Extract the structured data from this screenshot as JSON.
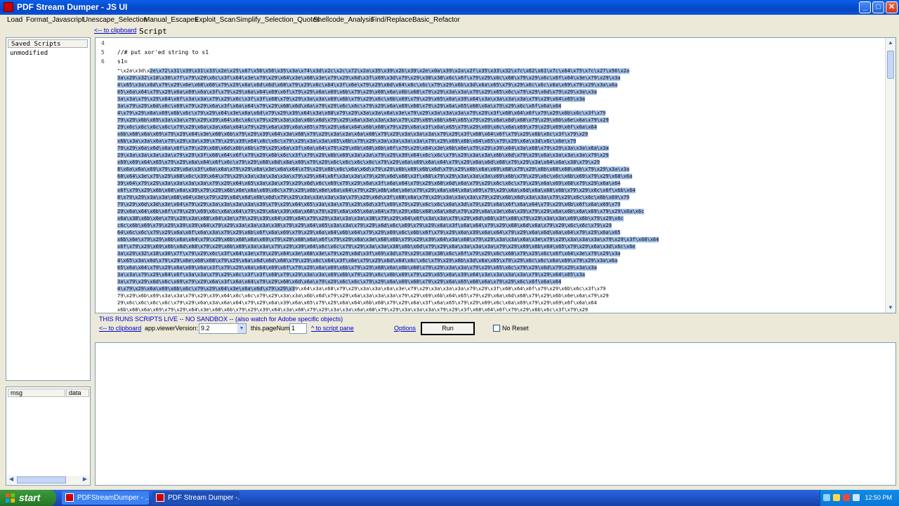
{
  "window": {
    "title": "PDF Stream Dumper  - JS UI",
    "min": "_",
    "max": "□",
    "close": "✕"
  },
  "menu": [
    "Load",
    "Format_Javascript",
    "Unescape_Selection",
    "Manual_Escapes",
    "Exploit_Scan",
    "Simplify_Selection_Quotes",
    "Shellcode_Analysis",
    "Find/Replace",
    "Basic_Refactor"
  ],
  "toolbar": {
    "clipboard_link": "<-- to clipboard",
    "script_label": "Script"
  },
  "saved_scripts": {
    "header": "Saved Scripts",
    "items": [
      "unmodified"
    ]
  },
  "editor": {
    "line_numbers": [
      "4",
      "5",
      "6"
    ],
    "comment": "//# put xor'ed string to s1",
    "assign": "s1=",
    "first_hex_row": "\"\\x2a\\x3d\\x2e\\x72\\x31\\x39\\x31\\x33\\x2e\\x25\\x67\\x56\\x56\\x35\\x3a\\x74\\x3d\\x2c\\x2c\\x72\\x2a\\x35\\x39\\x2b\\x39\\x2e\\x0a\\x39\\x2a\\x2f\\x35\\x33\\x32\\x7c\\x62\\x61\\x7c\\x64\\x75\\x7c\\x27\\x56\\x2a",
    "hex_rows": [
      "3a\\x29\\x32\\x18\\x30\\x7f\\x79\\x29\\x6c\\x3f\\x64\\x3e\\x79\\x29\\x64\\x3e\\x68\\x3e\\x79\\x29\\x6d\\x3f\\x69\\x3d\\x79\\x29\\x38\\x38\\x6c\\x6f\\x79\\x29\\x6c\\x68\\x79\\x29\\x6c\\x6f\\x64\\x3e\\x79\\x29\\x3a",
      "4\\x65\\x3a\\x6d\\x79\\x29\\x6e\\x68\\x68\\x79\\x29\\x6a\\x6d\\x6d\\x68\\x79\\x29\\x6c\\x64\\x3f\\x6e\\x79\\x29\\x6d\\x64\\x6c\\x6c\\x79\\x29\\x6b\\x3d\\x6a\\x65\\x79\\x29\\x6c\\x6c\\x6a\\x69\\x79\\x29\\x3a\\x6a",
      "65\\x6a\\x64\\x79\\x29\\x6a\\x69\\x6a\\x3f\\x79\\x29\\x6a\\x64\\x69\\x6f\\x79\\x29\\x6a\\x69\\x6b\\x79\\x29\\x68\\x6a\\x6b\\x68\\x79\\x29\\x3a\\x3a\\x79\\x29\\x65\\x6c\\x79\\x29\\x6d\\x79\\x29\\x3a\\x3a",
      "3a\\x3a\\x79\\x29\\x64\\x6f\\x3a\\x3a\\x79\\x29\\x6c\\x3f\\x3f\\x68\\x79\\x29\\x3a\\x3a\\x69\\x6b\\x79\\x29\\x6c\\x6b\\x69\\x79\\x29\\x65\\x6a\\x39\\x64\\x3a\\x3a\\x3a\\x3a\\x79\\x29\\x64\\x65\\x3a",
      "3a\\x79\\x29\\x6d\\x6c\\x69\\x79\\x29\\x6a\\x3f\\x6a\\x64\\x79\\x29\\x68\\x6d\\x6a\\x79\\x29\\x6c\\x6c\\x79\\x29\\x6a\\x69\\x68\\x79\\x29\\x6a\\x65\\x68\\x6a\\x79\\x29\\x6c\\x6f\\x6a\\x64",
      "4\\x79\\x29\\x6a\\x69\\x6b\\x6c\\x79\\x29\\x64\\x3e\\x6a\\x6d\\x79\\x29\\x39\\x64\\x3a\\x68\\x79\\x29\\x3a\\x3a\\x6a\\x3e\\x79\\x29\\x3a\\x3a\\x3a\\x79\\x29\\x3f\\x68\\x64\\x6f\\x79\\x29\\x6b\\x6c\\x3f\\x79",
      "79\\x29\\x6b\\x69\\x3a\\x3a\\x79\\x29\\x39\\x64\\x6c\\x6c\\x79\\x29\\x3a\\x3a\\x6b\\x6d\\x79\\x29\\x6a\\x3a\\x3a\\x3a\\x79\\x29\\x69\\x6b\\x64\\x65\\x79\\x29\\x6a\\x6d\\x68\\x79\\x29\\x6b\\x6e\\x6a\\x79\\x29",
      "29\\x6c\\x6c\\x6c\\x6c\\x79\\x29\\x6a\\x3a\\x6a\\x64\\x79\\x29\\x6a\\x39\\x6a\\x65\\x79\\x29\\x6a\\x64\\x6b\\x68\\x79\\x29\\x6a\\x3f\\x6a\\x65\\x79\\x29\\x69\\x6c\\x6a\\x69\\x79\\x29\\x69\\x6f\\x6a\\x64",
      "x6b\\x68\\x6a\\x69\\x79\\x29\\x64\\x3e\\x68\\x6b\\x79\\x29\\x39\\x64\\x3a\\x68\\x79\\x29\\x3a\\x3a\\x6a\\x68\\x79\\x29\\x3a\\x3a\\x3a\\x79\\x29\\x3f\\x68\\x64\\x6f\\x79\\x29\\x6b\\x6c\\x3f\\x79\\x29",
      "x6b\\x3a\\x3a\\x6a\\x79\\x29\\x3a\\x39\\x79\\x29\\x39\\x64\\x6c\\x6c\\x79\\x29\\x3a\\x3a\\x65\\x6b\\x79\\x29\\x3a\\x3a\\x3a\\x3a\\x79\\x29\\x69\\x6b\\x64\\x65\\x79\\x29\\x6a\\x3d\\x6c\\x6e\\x79",
      "79\\x29\\x6a\\x6d\\x6a\\x6f\\x79\\x29\\x68\\x6d\\x6b\\x6b\\x79\\x29\\x6a\\x3f\\x6a\\x64\\x79\\x29\\x6b\\x68\\x6b\\x6f\\x79\\x29\\x64\\x3e\\x6b\\x6e\\x79\\x29\\x39\\x64\\x3a\\x68\\x79\\x29\\x3a\\x3a\\x6a\\x3a",
      "29\\x3a\\x3a\\x3a\\x3a\\x79\\x29\\x3f\\x68\\x64\\x6f\\x79\\x29\\x6b\\x6c\\x3f\\x79\\x29\\x6b\\x69\\x3a\\x3a\\x79\\x29\\x39\\x64\\x6c\\x6c\\x79\\x29\\x3a\\x3a\\x6b\\x6d\\x79\\x29\\x6a\\x3a\\x3a\\x3a\\x79\\x29",
      "x69\\x69\\x64\\x65\\x79\\x29\\x6a\\x64\\x6f\\x6c\\x79\\x29\\x68\\x6d\\x6a\\x69\\x79\\x29\\x6c\\x6c\\x6c\\x6c\\x79\\x29\\x6a\\x69\\x6a\\x64\\x79\\x29\\x6a\\x6d\\x68\\x79\\x29\\x3a\\x64\\x6a\\x38\\x79\\x29",
      "8\\x6a\\x6a\\x69\\x79\\x29\\x6a\\x3f\\x6a\\x6a\\x79\\x29\\x6a\\x3e\\x6a\\x64\\x79\\x29\\x6b\\x6c\\x6a\\x6d\\x79\\x29\\x6b\\x69\\x6b\\x6d\\x79\\x29\\x6b\\x6a\\x69\\x68\\x79\\x29\\x6b\\x68\\x68\\x6b\\x79\\x29\\x3a\\x3a",
      "68\\x64\\x3e\\x79\\x29\\x68\\x6c\\x39\\x64\\x79\\x29\\x3a\\x3a\\x3a\\x3a\\x79\\x29\\x64\\x6f\\x3a\\x3a\\x79\\x29\\x6d\\x68\\x3f\\x68\\x79\\x29\\x3a\\x3a\\x3a\\x69\\x6b\\x79\\x29\\x6c\\x6c\\x6b\\x69\\x79\\x29\\x68\\x6a",
      "39\\x64\\x79\\x29\\x3a\\x3a\\x3a\\x3a\\x79\\x29\\x64\\x65\\x3a\\x3a\\x79\\x29\\x6d\\x6c\\x69\\x79\\x29\\x6a\\x3f\\x6a\\x64\\x79\\x29\\x68\\x6d\\x6a\\x79\\x29\\x6c\\x6c\\x79\\x29\\x6a\\x69\\x68\\x79\\x29\\x6a\\x64",
      "x6f\\x79\\x29\\x6b\\x68\\x6a\\x39\\x79\\x29\\x6b\\x6e\\x6a\\x69\\x6c\\x79\\x29\\x6b\\x6e\\x6a\\x64\\x79\\x29\\x6b\\x6e\\x6e\\x79\\x29\\x6a\\x64\\x6a\\x69\\x79\\x29\\x6a\\x6d\\x6a\\x68\\x6b\\x79\\x29\\x6c\\x6f\\x6b\\x64",
      "8\\x79\\x29\\x3a\\x3a\\x68\\x64\\x3e\\x79\\x29\\x6d\\x6d\\x6b\\x6d\\x79\\x29\\x3a\\x3a\\x3a\\x3a\\x79\\x29\\x6d\\x3f\\x68\\x6a\\x79\\x29\\x3a\\x3a\\x3a\\x79\\x29\\x6b\\x6d\\x3a\\x3a\\x79\\x29\\x6c\\x6c\\x6b\\x69\\x79",
      "79\\x29\\x6d\\x3d\\x3e\\x64\\x79\\x29\\x3a\\x3a\\x3a\\x3a\\x39\\x79\\x29\\x64\\x65\\x3a\\x3a\\x79\\x29\\x6d\\x3f\\x69\\x79\\x29\\x6c\\x6c\\x6a\\x3d\\x79\\x29\\x6a\\x6f\\x6a\\x64\\x79\\x29\\x6b\\x6f\\x6a\\x69\\x79",
      "29\\x6a\\x64\\x6b\\x6f\\x79\\x29\\x69\\x6c\\x6a\\x64\\x79\\x29\\x6a\\x39\\x6a\\x68\\x79\\x29\\x6a\\x65\\x6a\\x64\\x79\\x29\\x6b\\x68\\x6a\\x6d\\x79\\x29\\x6a\\x3e\\x6a\\x39\\x79\\x29\\x6a\\x6b\\x6a\\x69\\x79\\x29\\x6a\\x6c",
      "x6a\\x38\\x6b\\x6e\\x79\\x29\\x3a\\x68\\x64\\x3e\\x79\\x29\\x39\\x64\\x39\\x64\\x79\\x29\\x3a\\x3a\\x3a\\x38\\x79\\x29\\x64\\x6f\\x3a\\x3a\\x79\\x29\\x6d\\x68\\x3f\\x68\\x79\\x29\\x3a\\x3a\\x69\\x6b\\x79\\x29\\x6c",
      "c6c\\x6b\\x69\\x79\\x29\\x39\\x39\\x64\\x79\\x29\\x3a\\x3a\\x3a\\x38\\x79\\x29\\x64\\x65\\x3a\\x3a\\x79\\x29\\x6d\\x6c\\x69\\x79\\x29\\x6a\\x3f\\x6a\\x64\\x79\\x29\\x68\\x6d\\x6a\\x79\\x29\\x6c\\x6c\\x79\\x29",
      "64\\x6c\\x6c\\x79\\x29\\x6a\\x6f\\x6a\\x3a\\x79\\x29\\x6b\\x6f\\x6a\\x69\\x79\\x29\\x6a\\x64\\x6b\\x64\\x79\\x29\\x69\\x6c\\x6b\\x6f\\x79\\x29\\x6a\\x39\\x6a\\x64\\x79\\x29\\x6a\\x6d\\x6a\\x64\\x79\\x29\\x6a\\x65",
      "x6b\\x6e\\x79\\x29\\x6b\\x6a\\x64\\x79\\x29\\x6b\\x68\\x6a\\x69\\x79\\x29\\x68\\x6a\\x6f\\x79\\x29\\x6a\\x3e\\x68\\x6b\\x79\\x29\\x39\\x64\\x3a\\x68\\x79\\x29\\x3a\\x3a\\x6a\\x3e\\x79\\x29\\x3a\\x3a\\x3a\\x79\\x29\\x3f\\x68\\x64",
      "x6f\\x79\\x29\\x69\\x6b\\x6d\\x68\\x79\\x29\\x6b\\x69\\x3a\\x3a\\x79\\x29\\x39\\x64\\x6c\\x6c\\x79\\x29\\x3a\\x3a\\x38\\x6b\\x6d\\x79\\x29\\x6a\\x3a\\x3a\\x3a\\x79\\x29\\x69\\x6b\\x64\\x65\\x79\\x29\\x6a\\x3d\\x6c\\x6e"
    ],
    "selected_rows": 31
  },
  "controls": {
    "warning": "THIS RUNS SCRIPTS LIVE -- NO SANDBOX -- (also watch for Adobe specific objects)",
    "clipboard_link": "<-- to clipboard",
    "version_label": "app.viewerVersion:",
    "version_value": "9.2",
    "page_label": "this.pageNum",
    "page_value": "1",
    "script_pane_link": "^ to script pane",
    "options_link": "Options",
    "run_label": "Run",
    "noreset_label": "No Reset"
  },
  "msg_panel": {
    "col_msg": "msg",
    "col_data": "data"
  },
  "taskbar": {
    "start": "start",
    "tasks": [
      "PDFStreamDumper - ...",
      "PDF Stream Dumper -..."
    ],
    "clock": "12:50 PM"
  },
  "colors": {
    "selection": "#a6c2ec",
    "link": "#0000cc",
    "titlebar": "#0a52d8"
  }
}
